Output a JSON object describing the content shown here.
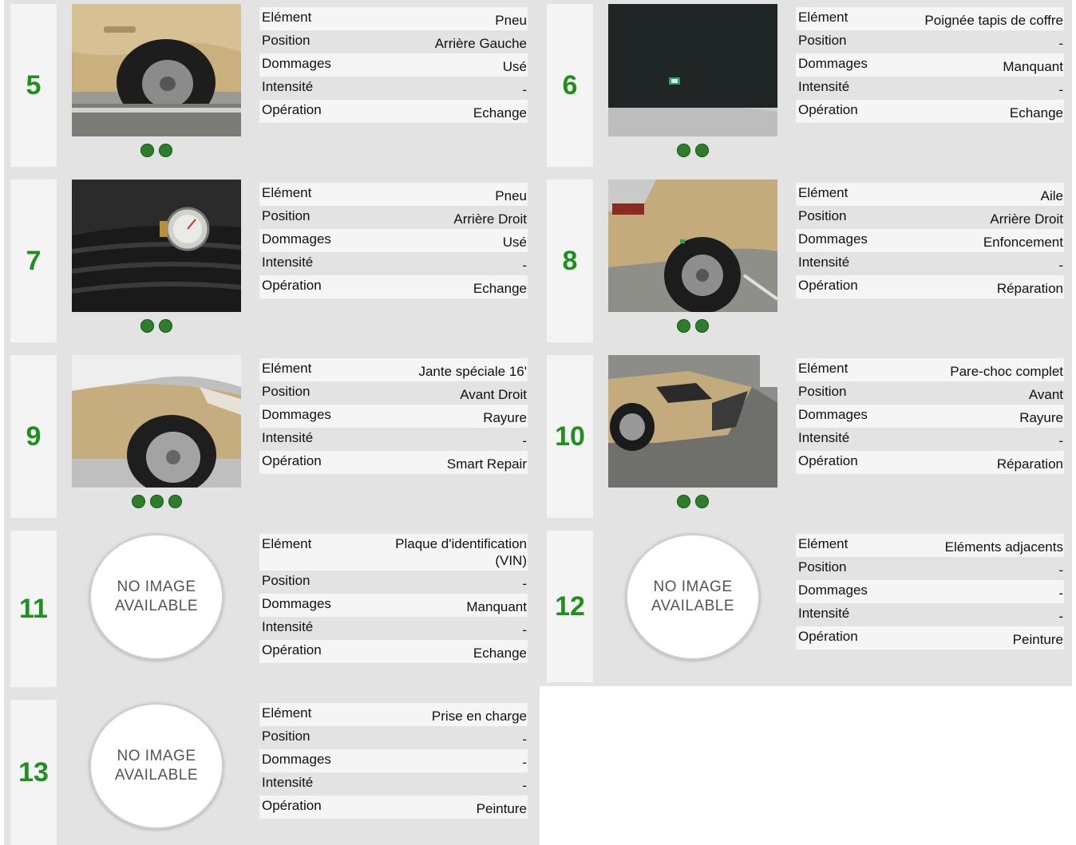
{
  "labels": {
    "element": "Elément",
    "position": "Position",
    "damage": "Dommages",
    "intensity": "Intensité",
    "operation": "Opération"
  },
  "no_image": {
    "line1": "NO IMAGE",
    "line2": "AVAILABLE"
  },
  "colors": {
    "number": "#1f8f1f",
    "dot": "#2d7d2d",
    "panel": "#e3e3e3"
  },
  "items": [
    {
      "number": "5",
      "element": "Pneu",
      "position": "Arrière Gauche",
      "damage": "Usé",
      "intensity": "-",
      "operation": "Echange",
      "photos": 2,
      "image": "car-rear-left-tire-photo"
    },
    {
      "number": "6",
      "element": "Poignée tapis de coffre",
      "position": "-",
      "damage": "Manquant",
      "intensity": "-",
      "operation": "Echange",
      "photos": 2,
      "image": "trunk-mat-photo"
    },
    {
      "number": "7",
      "element": "Pneu",
      "position": "Arrière Droit",
      "damage": "Usé",
      "intensity": "-",
      "operation": "Echange",
      "photos": 2,
      "image": "tread-gauge-photo"
    },
    {
      "number": "8",
      "element": "Aile",
      "position": "Arrière Droit",
      "damage": "Enfoncement",
      "intensity": "-",
      "operation": "Réparation",
      "photos": 2,
      "image": "rear-wing-photo"
    },
    {
      "number": "9",
      "element": "Jante spéciale 16'",
      "position": "Avant Droit",
      "damage": "Rayure",
      "intensity": "-",
      "operation": "Smart Repair",
      "photos": 3,
      "image": "front-wheel-photo"
    },
    {
      "number": "10",
      "element": "Pare-choc complet",
      "position": "Avant",
      "damage": "Rayure",
      "intensity": "-",
      "operation": "Réparation",
      "photos": 2,
      "image": "front-bumper-photo"
    },
    {
      "number": "11",
      "element": "Plaque d'identification (VIN)",
      "position": "-",
      "damage": "Manquant",
      "intensity": "-",
      "operation": "Echange",
      "photos": 0,
      "image": ""
    },
    {
      "number": "12",
      "element": "Eléments adjacents",
      "position": "-",
      "damage": "-",
      "intensity": "-",
      "operation": "Peinture",
      "photos": 0,
      "image": ""
    },
    {
      "number": "13",
      "element": "Prise en charge",
      "position": "-",
      "damage": "-",
      "intensity": "-",
      "operation": "Peinture",
      "photos": 0,
      "image": ""
    }
  ]
}
